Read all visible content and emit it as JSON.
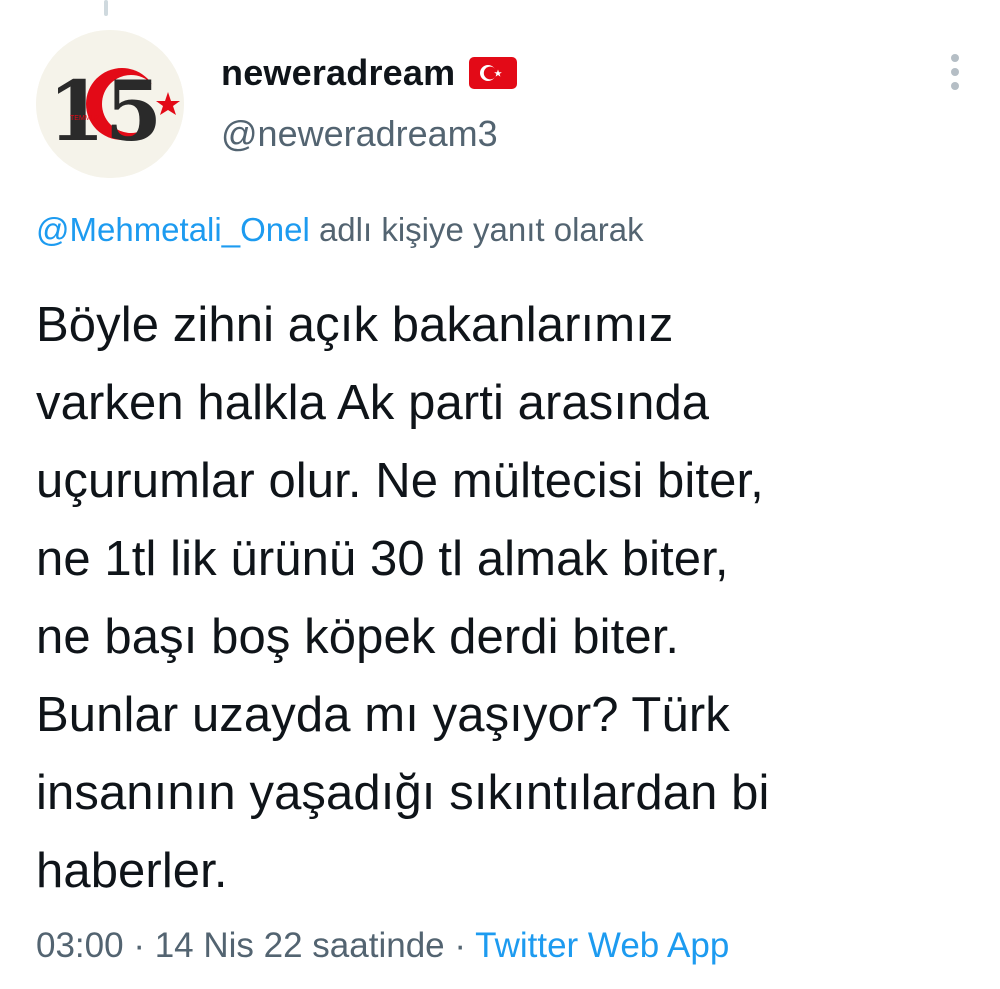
{
  "author": {
    "display_name": "neweradream",
    "handle": "@neweradream3",
    "flag_icon": "turkey-flag-icon",
    "avatar": {
      "number_text": "15",
      "label_text": "TEMMUZ",
      "colors": {
        "number": "#2a2a2a",
        "crescent": "#e30a17",
        "background": "#f5f3ea"
      }
    }
  },
  "reply_context": {
    "mention": "@Mehmetali_Onel",
    "suffix": "adlı kişiye yanıt olarak"
  },
  "tweet": {
    "text": "Böyle zihni açık bakanlarımız\nvarken halkla Ak parti arasında\nuçurumlar olur. Ne mültecisi biter,\nne 1tl lik ürünü 30 tl almak biter,\nne başı boş köpek derdi biter.\nBunlar uzayda mı yaşıyor? Türk\ninsanının yaşadığı sıkıntılardan bi\nhaberler."
  },
  "meta": {
    "time": "03:00",
    "separator": "·",
    "date": "14 Nis 22 saatinde",
    "source": "Twitter Web App"
  },
  "colors": {
    "text_primary": "#0f1419",
    "text_secondary": "#536471",
    "link": "#1d9bf0",
    "flag_red": "#e30a17"
  },
  "icons": {
    "more": "more-vertical-icon"
  }
}
